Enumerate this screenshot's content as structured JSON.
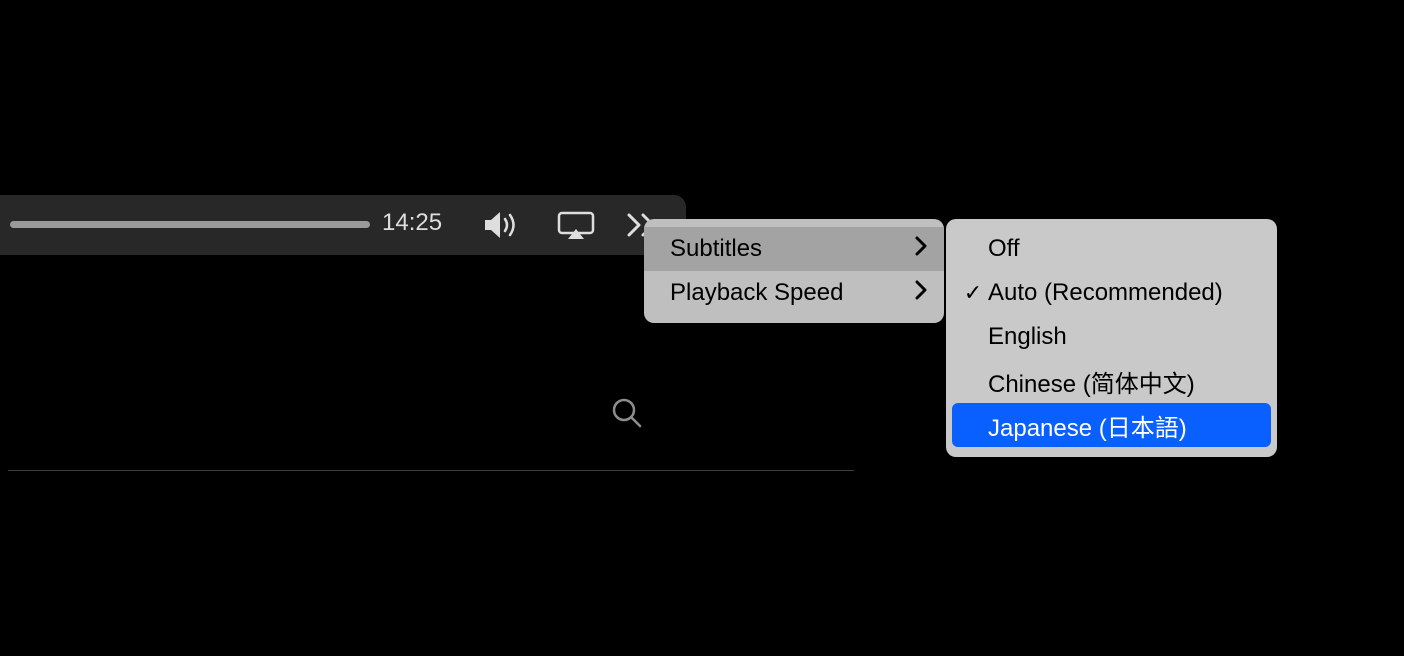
{
  "player": {
    "time_remaining": "14:25"
  },
  "menu_primary": {
    "items": [
      {
        "label": "Subtitles",
        "active": true
      },
      {
        "label": "Playback Speed",
        "active": false
      }
    ]
  },
  "menu_secondary": {
    "items": [
      {
        "label": "Off",
        "checked": false,
        "highlighted": false
      },
      {
        "label": "Auto (Recommended)",
        "checked": true,
        "highlighted": false
      },
      {
        "label": "English",
        "checked": false,
        "highlighted": false
      },
      {
        "label": "Chinese (简体中文)",
        "checked": false,
        "highlighted": false
      },
      {
        "label": "Japanese (日本語)",
        "checked": false,
        "highlighted": true
      }
    ]
  },
  "colors": {
    "highlight": "#0a60ff",
    "menu_bg": "#c9c9c9",
    "menu_active": "#a3a3a3"
  }
}
